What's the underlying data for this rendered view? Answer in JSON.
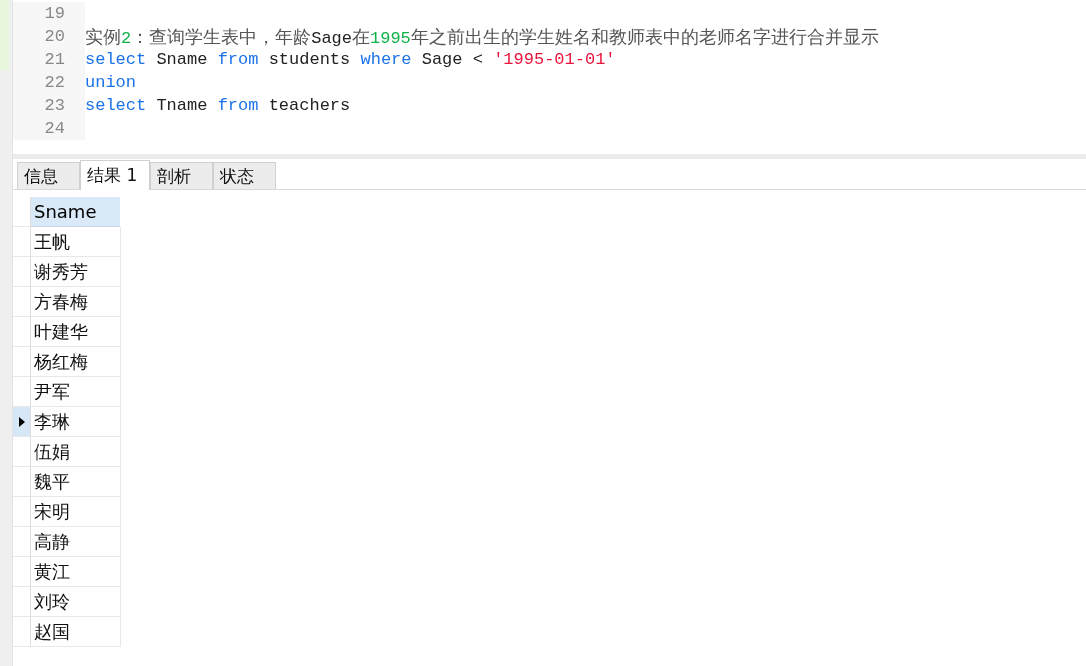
{
  "editor": {
    "lines": [
      {
        "number": "19"
      },
      {
        "number": "20",
        "segments": [
          {
            "kind": "comment",
            "text": "实例"
          },
          {
            "kind": "number",
            "text": "2"
          },
          {
            "kind": "comment",
            "text": "：查询学生表中，年龄"
          },
          {
            "kind": "plain",
            "text": "Sage"
          },
          {
            "kind": "comment",
            "text": "在"
          },
          {
            "kind": "number",
            "text": "1995"
          },
          {
            "kind": "comment",
            "text": "年之前出生的学生姓名和教师表中的老师名字进行合并显示"
          }
        ]
      },
      {
        "number": "21",
        "segments": [
          {
            "kind": "keyword",
            "text": "select"
          },
          {
            "kind": "plain",
            "text": " Sname "
          },
          {
            "kind": "keyword",
            "text": "from"
          },
          {
            "kind": "plain",
            "text": " students "
          },
          {
            "kind": "keyword",
            "text": "where"
          },
          {
            "kind": "plain",
            "text": " Sage < "
          },
          {
            "kind": "string",
            "text": "'1995-01-01'"
          }
        ]
      },
      {
        "number": "22",
        "segments": [
          {
            "kind": "keyword",
            "text": "union"
          }
        ]
      },
      {
        "number": "23",
        "segments": [
          {
            "kind": "keyword",
            "text": "select"
          },
          {
            "kind": "plain",
            "text": " Tname "
          },
          {
            "kind": "keyword",
            "text": "from"
          },
          {
            "kind": "plain",
            "text": " teachers"
          }
        ]
      },
      {
        "number": "24"
      }
    ]
  },
  "tabs": [
    {
      "label": "信息",
      "selected": false
    },
    {
      "label": "结果 1",
      "selected": true
    },
    {
      "label": "剖析",
      "selected": false
    },
    {
      "label": "状态",
      "selected": false
    }
  ],
  "table": {
    "columns": [
      "Sname"
    ],
    "rows": [
      {
        "cells": [
          "王帆"
        ],
        "selected": false
      },
      {
        "cells": [
          "谢秀芳"
        ],
        "selected": false
      },
      {
        "cells": [
          "方春梅"
        ],
        "selected": false
      },
      {
        "cells": [
          "叶建华"
        ],
        "selected": false
      },
      {
        "cells": [
          "杨红梅"
        ],
        "selected": false
      },
      {
        "cells": [
          "尹军"
        ],
        "selected": false
      },
      {
        "cells": [
          "李琳"
        ],
        "selected": true
      },
      {
        "cells": [
          "伍娟"
        ],
        "selected": false
      },
      {
        "cells": [
          "魏平"
        ],
        "selected": false
      },
      {
        "cells": [
          "宋明"
        ],
        "selected": false
      },
      {
        "cells": [
          "高静"
        ],
        "selected": false
      },
      {
        "cells": [
          "黄江"
        ],
        "selected": false
      },
      {
        "cells": [
          "刘玲"
        ],
        "selected": false
      },
      {
        "cells": [
          "赵国"
        ],
        "selected": false
      }
    ]
  }
}
